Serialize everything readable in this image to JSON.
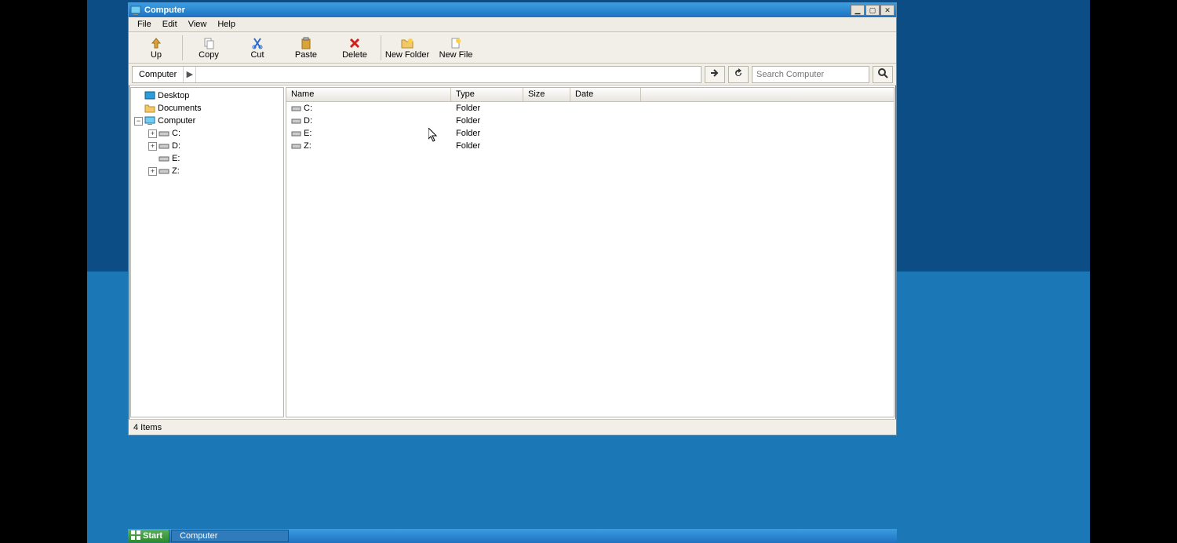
{
  "window": {
    "title": "Computer",
    "controls": {
      "min": "_",
      "max": "□",
      "close": "✕"
    }
  },
  "menu": [
    "File",
    "Edit",
    "View",
    "Help"
  ],
  "toolbar": [
    {
      "id": "up",
      "label": "Up"
    },
    {
      "id": "copy",
      "label": "Copy"
    },
    {
      "id": "cut",
      "label": "Cut"
    },
    {
      "id": "paste",
      "label": "Paste"
    },
    {
      "id": "delete",
      "label": "Delete"
    },
    {
      "id": "newfolder",
      "label": "New Folder"
    },
    {
      "id": "newfile",
      "label": "New File"
    }
  ],
  "address": {
    "segment": "Computer",
    "arrow": "▶"
  },
  "search": {
    "placeholder": "Search Computer"
  },
  "tree": {
    "desktop": "Desktop",
    "documents": "Documents",
    "computer": "Computer",
    "drives": [
      "C:",
      "D:",
      "E:",
      "Z:"
    ]
  },
  "columns": {
    "name": "Name",
    "type": "Type",
    "size": "Size",
    "date": "Date"
  },
  "rows": [
    {
      "name": "C:",
      "type": "Folder",
      "size": "",
      "date": ""
    },
    {
      "name": "D:",
      "type": "Folder",
      "size": "",
      "date": ""
    },
    {
      "name": "E:",
      "type": "Folder",
      "size": "",
      "date": ""
    },
    {
      "name": "Z:",
      "type": "Folder",
      "size": "",
      "date": ""
    }
  ],
  "status": "4 Items",
  "taskbar": {
    "start": "Start",
    "task": "Computer"
  }
}
